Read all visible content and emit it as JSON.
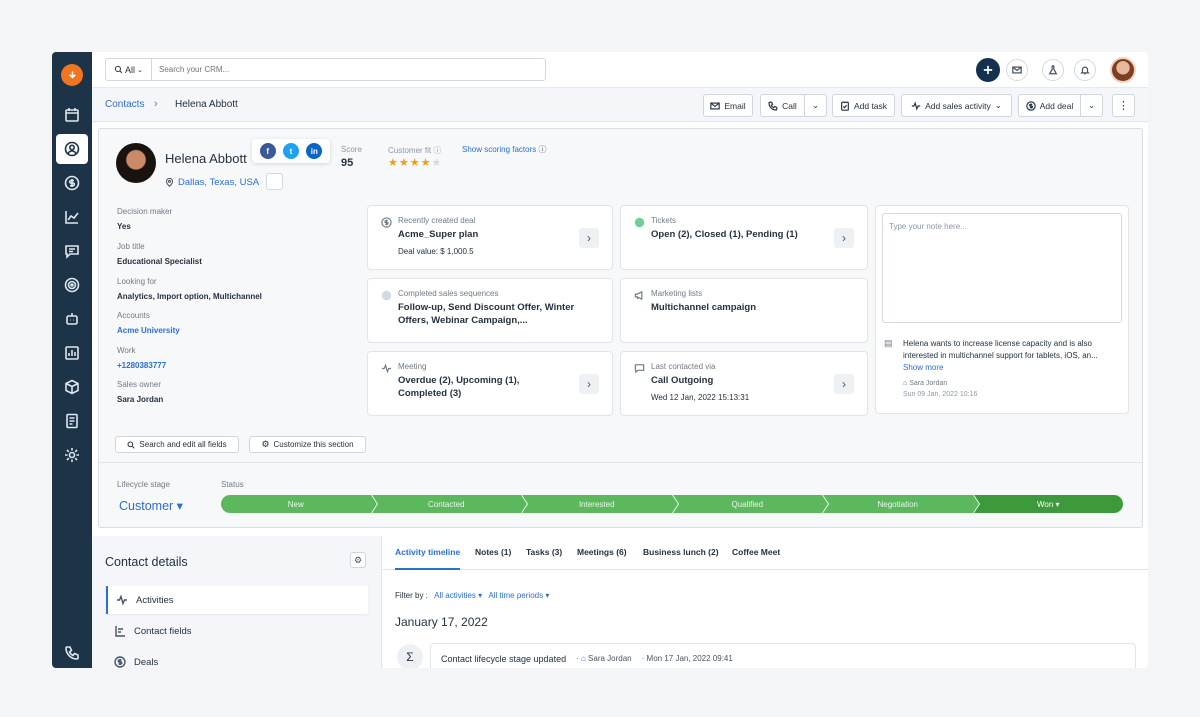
{
  "top": {
    "search_scope": "All",
    "search_placeholder": "Search your CRM..."
  },
  "breadcrumb": {
    "parent": "Contacts",
    "separator": "›",
    "current": "Helena Abbott"
  },
  "actions": {
    "email": "Email",
    "call": "Call",
    "add_task": "Add task",
    "add_sales_activity": "Add sales activity",
    "add_deal": "Add deal"
  },
  "profile": {
    "name": "Helena Abbott",
    "location": "Dallas, Texas, USA",
    "score_label": "Score",
    "score_value": "95",
    "fit_label": "Customer fit",
    "fit_stars": 4,
    "fit_max": 5,
    "show_scoring": "Show scoring factors"
  },
  "fields": [
    {
      "label": "Decision maker",
      "value": "Yes"
    },
    {
      "label": "Job title",
      "value": "Educational Specialist"
    },
    {
      "label": "Looking for",
      "value": "Analytics, Import option, Multichannel"
    },
    {
      "label": "Accounts",
      "value": "Acme University"
    },
    {
      "label": "Work",
      "value": "+1280383777"
    },
    {
      "label": "Sales owner",
      "value": "Sara Jordan"
    }
  ],
  "section_buttons": {
    "search_edit": "Search and edit all fields",
    "customize": "Customize this section"
  },
  "cards": {
    "deal": {
      "title": "Recently created deal",
      "body": "Acme_Super plan",
      "sub": "Deal value: $ 1,000.5"
    },
    "tickets": {
      "title": "Tickets",
      "body": "Open (2), Closed (1), Pending (1)"
    },
    "sequences": {
      "title": "Completed sales sequences",
      "body": "Follow-up, Send Discount Offer, Winter Offers, Webinar Campaign,..."
    },
    "marketing": {
      "title": "Marketing lists",
      "body": "Multichannel campaign"
    },
    "meeting": {
      "title": "Meeting",
      "body": "Overdue (2), Upcoming (1), Completed (3)"
    },
    "contacted": {
      "title": "Last contacted via",
      "body": "Call Outgoing",
      "sub": "Wed 12 Jan, 2022 15:13:31"
    }
  },
  "note": {
    "placeholder": "Type your note here...",
    "text": "Helena wants to increase license capacity and is also interested in multichannel support for tablets, iOS, an...",
    "show_more": "Show more",
    "author": "Sara Jordan",
    "date": "Sun 09 Jan, 2022 10:16"
  },
  "lifecycle": {
    "label": "Lifecycle stage",
    "status_label": "Status",
    "stage": "Customer ▾",
    "statuses": [
      "New",
      "Contacted",
      "Interested",
      "Qualified",
      "Negotiation",
      "Won ▾"
    ]
  },
  "contact_details": {
    "title": "Contact details",
    "items": [
      "Activities",
      "Contact fields",
      "Deals"
    ]
  },
  "timeline": {
    "tabs": [
      "Activity timeline",
      "Notes (1)",
      "Tasks (3)",
      "Meetings (6)",
      "Business lunch (2)",
      "Coffee Meet"
    ],
    "filter_label": "Filter by :",
    "filter_activities": "All activities ▾",
    "filter_periods": "All time periods ▾",
    "date": "January 17, 2022",
    "entry_title": "Contact lifecycle stage updated",
    "entry_user": "Sara Jordan",
    "entry_time": "Mon 17 Jan, 2022 09:41"
  },
  "colors": {
    "sidebar": "#1c3348",
    "accent": "#2c6fcf",
    "pipeline": "#5cb85c",
    "pipeline_won": "#3c9a3c",
    "brand_logo": "#f0751f"
  }
}
